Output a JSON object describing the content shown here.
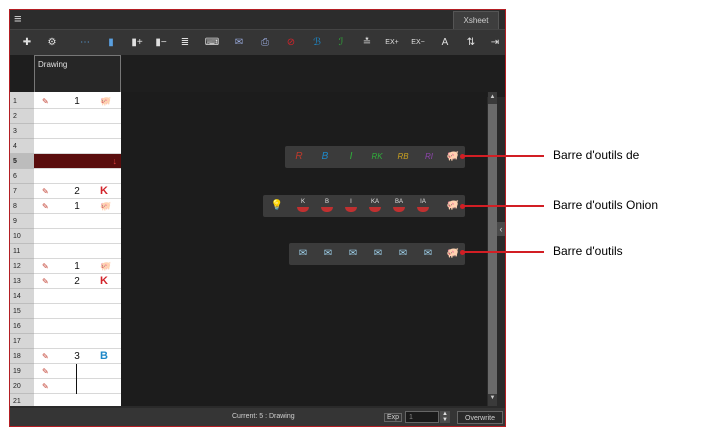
{
  "window": {
    "tab": "Xsheet",
    "column_header": "Drawing",
    "status_text": "Current: 5 : Drawing",
    "exp_label": "Exp",
    "exp_value": "1",
    "overwrite_label": "Overwrite"
  },
  "toolbar": {
    "icons": [
      "add-drawing-icon",
      "gear-icon",
      "show-columns-icon",
      "add-column-icon",
      "insert-column-icon",
      "remove-column-icon",
      "sequence-fill-icon",
      "scan-icon",
      "mark-keyframe-icon",
      "cut-icon",
      "red-mark-icon",
      "blue-mark-icon",
      "green-mark-icon",
      "pencil-up-icon",
      "increase-exposure-icon",
      "decrease-exposure-icon",
      "text-icon",
      "exposure-icon",
      "layer-icon"
    ],
    "ex_plus": "EX\n+",
    "ex_minus": "EX\n−"
  },
  "rows": [
    {
      "n": "1",
      "pen": true,
      "num": "1",
      "mark": "pig"
    },
    {
      "n": "2"
    },
    {
      "n": "3"
    },
    {
      "n": "4"
    },
    {
      "n": "5",
      "selected": true
    },
    {
      "n": "6"
    },
    {
      "n": "7",
      "pen": true,
      "num": "2",
      "mark": "K"
    },
    {
      "n": "8",
      "pen": true,
      "num": "1",
      "mark": "pig"
    },
    {
      "n": "9"
    },
    {
      "n": "10"
    },
    {
      "n": "11"
    },
    {
      "n": "12",
      "pen": true,
      "num": "1",
      "mark": "pig"
    },
    {
      "n": "13",
      "pen": true,
      "num": "2",
      "mark": "K"
    },
    {
      "n": "14"
    },
    {
      "n": "15"
    },
    {
      "n": "16"
    },
    {
      "n": "17"
    },
    {
      "n": "18",
      "pen": true,
      "num": "3",
      "mark": "B"
    },
    {
      "n": "19",
      "pen": true,
      "hold": true
    },
    {
      "n": "20",
      "pen": true,
      "hold": true
    },
    {
      "n": "21"
    }
  ],
  "float_toolbars": {
    "marks": [
      "R",
      "B",
      "I",
      "RK",
      "RB",
      "RI"
    ],
    "onion": [
      "K",
      "B",
      "I",
      "KA",
      "BA",
      "IA"
    ]
  },
  "callouts": {
    "first": "Barre d'outils de",
    "second": "Barre d'outils Onion",
    "third": "Barre d'outils"
  },
  "colors": {
    "callout_red": "#d21e24",
    "selected_row": "#5a0e0e",
    "key_red": "#d2232a",
    "breakdown_blue": "#1e88c8"
  }
}
